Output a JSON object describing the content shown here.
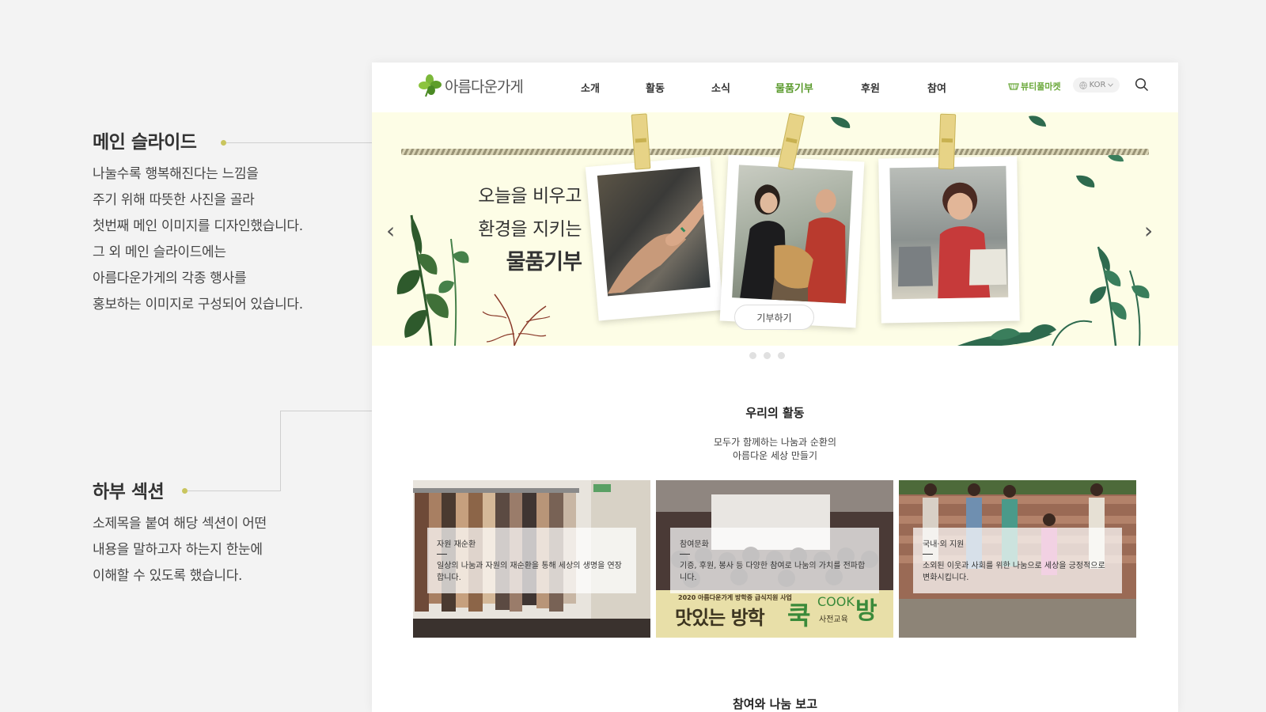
{
  "annotations": [
    {
      "title": "메인 슬라이드",
      "lines": [
        "나눌수록 행복해진다는 느낌을",
        "주기 위해 따뜻한 사진을 골라",
        "첫번째 메인 이미지를 디자인했습니다.",
        "그 외 메인 슬라이드에는",
        "아름다운가게의 각종 행사를",
        "홍보하는 이미지로 구성되어 있습니다."
      ]
    },
    {
      "title": "하부 섹션",
      "lines": [
        "소제목을 붙여 해당 섹션이 어떤",
        "내용을 말하고자 하는지 한눈에",
        "이해할 수 있도록 했습니다."
      ]
    }
  ],
  "header": {
    "logo_text": "아름다운가게",
    "nav": [
      "소개",
      "활동",
      "소식",
      "물품기부",
      "후원",
      "참여"
    ],
    "active_nav": "물품기부",
    "beauty_market": "뷰티풀마켓",
    "lang": "KOR"
  },
  "slider": {
    "line1": "오늘을 비우고",
    "line2": "환경을 지키는",
    "line3": "물품기부",
    "button": "기부하기",
    "prev": "‹",
    "next": "›"
  },
  "activities": {
    "title": "우리의 활동",
    "subtitle_1": "모두가 함께하는 나눔과 순환의",
    "subtitle_2": "아름다운 세상 만들기",
    "cards": [
      {
        "category": "자원 재순환",
        "desc": "일상의 나눔과 자원의 재순환을 통해 세상의 생명을 연장합니다."
      },
      {
        "category": "참여문화",
        "desc": "기증, 후원, 봉사 등 다양한 참여로 나눔의 가치를 전파합니다.",
        "poster_top": "2020 아름다운가게 방학중 급식지원 사업",
        "poster_main": "맛있는 방학",
        "poster_cook": "쿡",
        "poster_cook2": "COOK",
        "poster_bang": "방",
        "poster_sub": "사전교육"
      },
      {
        "category": "국내·외 지원",
        "desc": "소외된 이웃과 사회를 위한 나눔으로 세상을 긍정적으로 변화시킵니다."
      }
    ]
  },
  "participation": {
    "title": "참여와 나눔 보고"
  },
  "colors": {
    "accent_green": "#5a9a2c",
    "slider_bg": "#fdfde6",
    "annotation_dot": "#c9c55e"
  }
}
